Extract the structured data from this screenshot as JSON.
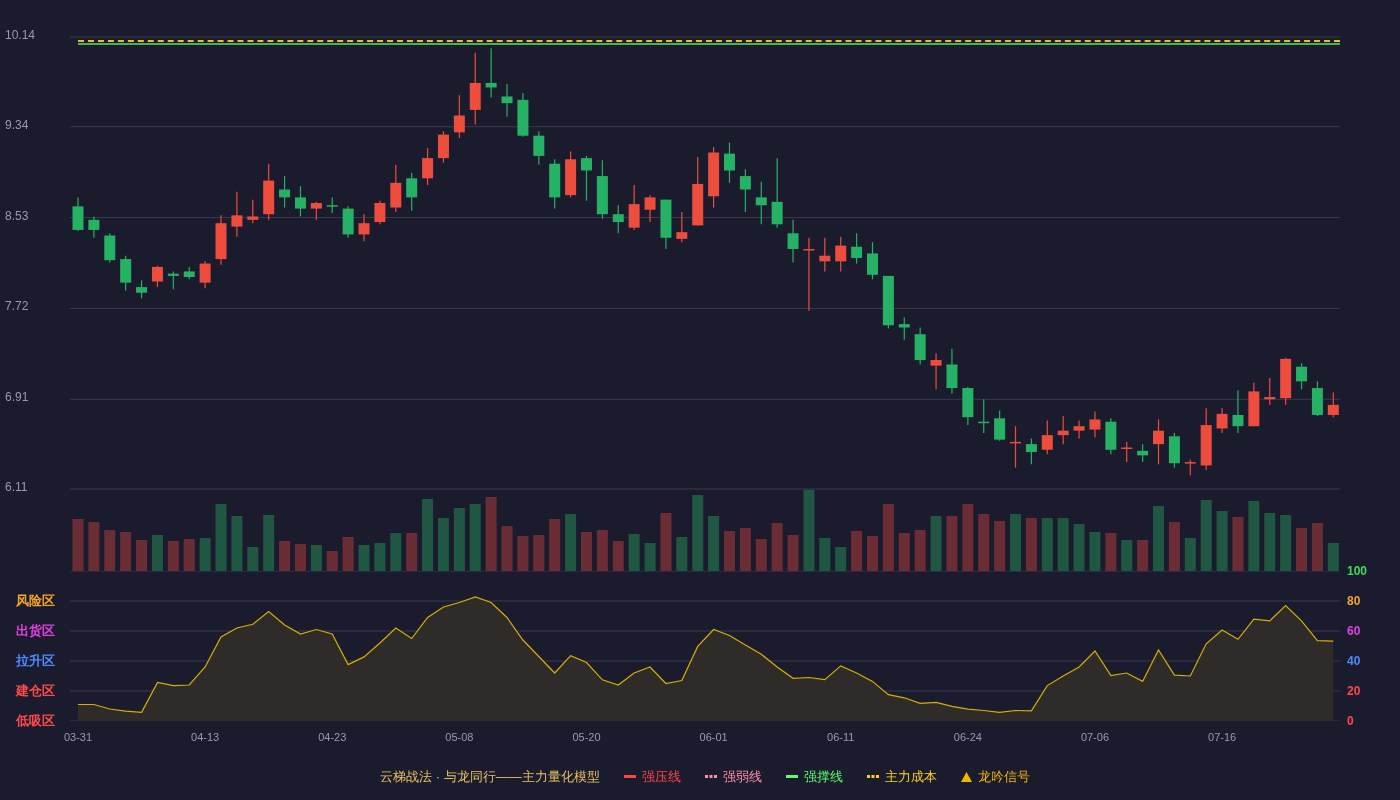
{
  "price_panel": {
    "guide_lines": [
      {
        "kind": "dashed",
        "color": "#e8c21a"
      },
      {
        "kind": "solid",
        "color": "#4caf50"
      }
    ],
    "chart_data": {
      "type": "candlestick",
      "ylim": [
        6.11,
        10.14
      ],
      "grid": true,
      "yticks": [
        {
          "value": 10.14,
          "label": "10.14"
        },
        {
          "value": 9.34,
          "label": "9.34"
        },
        {
          "value": 8.53,
          "label": "8.53"
        },
        {
          "value": 7.72,
          "label": "7.72"
        },
        {
          "value": 6.91,
          "label": "6.91"
        },
        {
          "value": 6.11,
          "label": "6.11"
        }
      ],
      "categories": [
        null,
        null,
        null,
        null,
        null,
        null,
        null,
        null,
        null,
        null,
        null,
        null,
        null,
        null,
        null,
        null,
        null,
        null,
        null,
        null,
        null,
        null,
        null,
        null,
        null,
        null,
        null,
        null,
        null,
        null,
        null,
        null,
        null,
        null,
        null,
        null,
        null,
        null,
        null,
        null,
        null,
        null,
        null,
        null,
        null,
        null,
        null,
        null,
        null,
        null,
        null,
        null,
        null,
        null,
        null,
        null,
        null,
        null,
        null,
        null,
        null,
        null,
        null,
        null,
        null,
        null,
        null,
        null,
        null,
        null,
        null,
        null,
        null,
        null,
        null,
        null,
        null,
        null,
        null,
        null
      ],
      "ohlc": [
        [
          8.63,
          8.71,
          8.41,
          8.42
        ],
        [
          8.51,
          8.54,
          8.35,
          8.42
        ],
        [
          8.37,
          8.39,
          8.13,
          8.15
        ],
        [
          8.16,
          8.19,
          7.88,
          7.95
        ],
        [
          7.91,
          7.97,
          7.81,
          7.86
        ],
        [
          7.96,
          8.1,
          7.91,
          8.09
        ],
        [
          8.03,
          8.05,
          7.89,
          8.01
        ],
        [
          8.05,
          8.09,
          7.98,
          8.0
        ],
        [
          7.95,
          8.14,
          7.9,
          8.12
        ],
        [
          8.16,
          8.55,
          8.11,
          8.48
        ],
        [
          8.45,
          8.76,
          8.36,
          8.55
        ],
        [
          8.51,
          8.69,
          8.48,
          8.54
        ],
        [
          8.56,
          9.01,
          8.51,
          8.86
        ],
        [
          8.78,
          8.9,
          8.62,
          8.71
        ],
        [
          8.71,
          8.81,
          8.54,
          8.61
        ],
        [
          8.61,
          8.67,
          8.51,
          8.66
        ],
        [
          8.64,
          8.71,
          8.57,
          8.63
        ],
        [
          8.61,
          8.63,
          8.35,
          8.38
        ],
        [
          8.38,
          8.56,
          8.32,
          8.48
        ],
        [
          8.49,
          8.68,
          8.47,
          8.66
        ],
        [
          8.62,
          9.0,
          8.58,
          8.84
        ],
        [
          8.88,
          8.93,
          8.59,
          8.71
        ],
        [
          8.88,
          9.15,
          8.82,
          9.06
        ],
        [
          9.06,
          9.3,
          9.02,
          9.27
        ],
        [
          9.29,
          9.62,
          9.24,
          9.44
        ],
        [
          9.49,
          10.0,
          9.36,
          9.73
        ],
        [
          9.73,
          10.04,
          9.6,
          9.69
        ],
        [
          9.61,
          9.72,
          9.43,
          9.55
        ],
        [
          9.58,
          9.64,
          9.25,
          9.26
        ],
        [
          9.26,
          9.3,
          9.0,
          9.08
        ],
        [
          9.01,
          9.05,
          8.61,
          8.71
        ],
        [
          8.73,
          9.12,
          8.71,
          9.05
        ],
        [
          9.06,
          9.08,
          8.68,
          8.95
        ],
        [
          8.9,
          9.04,
          8.52,
          8.56
        ],
        [
          8.56,
          8.64,
          8.39,
          8.49
        ],
        [
          8.44,
          8.82,
          8.42,
          8.65
        ],
        [
          8.6,
          8.73,
          8.49,
          8.71
        ],
        [
          8.69,
          8.69,
          8.25,
          8.35
        ],
        [
          8.34,
          8.58,
          8.31,
          8.4
        ],
        [
          8.46,
          9.07,
          8.46,
          8.83
        ],
        [
          8.72,
          9.16,
          8.62,
          9.11
        ],
        [
          9.1,
          9.2,
          8.84,
          8.95
        ],
        [
          8.9,
          8.96,
          8.58,
          8.78
        ],
        [
          8.71,
          8.85,
          8.47,
          8.64
        ],
        [
          8.67,
          9.06,
          8.44,
          8.47
        ],
        [
          8.39,
          8.51,
          8.13,
          8.25
        ],
        [
          8.24,
          8.35,
          7.7,
          8.25
        ],
        [
          8.14,
          8.35,
          8.05,
          8.19
        ],
        [
          8.14,
          8.36,
          8.05,
          8.28
        ],
        [
          8.27,
          8.39,
          8.12,
          8.17
        ],
        [
          8.21,
          8.31,
          7.98,
          8.02
        ],
        [
          8.01,
          8.01,
          7.54,
          7.57
        ],
        [
          7.58,
          7.64,
          7.44,
          7.55
        ],
        [
          7.49,
          7.55,
          7.22,
          7.26
        ],
        [
          7.21,
          7.32,
          7.0,
          7.26
        ],
        [
          7.22,
          7.36,
          6.96,
          7.01
        ],
        [
          7.01,
          7.02,
          6.68,
          6.75
        ],
        [
          6.71,
          6.91,
          6.61,
          6.7
        ],
        [
          6.74,
          6.81,
          6.54,
          6.55
        ],
        [
          6.52,
          6.67,
          6.3,
          6.53
        ],
        [
          6.51,
          6.56,
          6.33,
          6.44
        ],
        [
          6.46,
          6.72,
          6.42,
          6.59
        ],
        [
          6.59,
          6.76,
          6.51,
          6.63
        ],
        [
          6.63,
          6.72,
          6.56,
          6.67
        ],
        [
          6.64,
          6.8,
          6.57,
          6.73
        ],
        [
          6.71,
          6.74,
          6.42,
          6.46
        ],
        [
          6.47,
          6.53,
          6.35,
          6.48
        ],
        [
          6.45,
          6.51,
          6.35,
          6.41
        ],
        [
          6.51,
          6.73,
          6.33,
          6.63
        ],
        [
          6.58,
          6.61,
          6.3,
          6.34
        ],
        [
          6.34,
          6.37,
          6.23,
          6.35
        ],
        [
          6.32,
          6.83,
          6.28,
          6.68
        ],
        [
          6.65,
          6.83,
          6.61,
          6.78
        ],
        [
          6.77,
          6.99,
          6.61,
          6.67
        ],
        [
          6.67,
          7.06,
          6.67,
          6.98
        ],
        [
          6.91,
          7.1,
          6.86,
          6.93
        ],
        [
          6.92,
          7.28,
          6.86,
          7.27
        ],
        [
          7.2,
          7.23,
          7.0,
          7.07
        ],
        [
          7.01,
          7.07,
          6.76,
          6.77
        ],
        [
          6.77,
          6.97,
          6.75,
          6.86
        ]
      ]
    }
  },
  "indicator_panel": {
    "zones": [
      {
        "label": "风险区",
        "color": "#f5a623"
      },
      {
        "label": "出货区",
        "color": "#e040e0"
      },
      {
        "label": "拉升区",
        "color": "#4a8cff"
      },
      {
        "label": "建仓区",
        "color": "#ff4a4a"
      },
      {
        "label": "低吸区",
        "color": "#ff4a4a"
      }
    ],
    "tick_styles": [
      {
        "color": "#ff4a4a"
      },
      {
        "color": "#ff4a4a"
      },
      {
        "color": "#4a8cff"
      },
      {
        "color": "#e040e0"
      },
      {
        "color": "#f5a623"
      },
      {
        "color": "#3ddc5b"
      }
    ],
    "chart_data": {
      "type": "area",
      "ylim": [
        0,
        100
      ],
      "grid": true,
      "yticks": [
        {
          "value": 0,
          "label": "0"
        },
        {
          "value": 20,
          "label": "20"
        },
        {
          "value": 40,
          "label": "40"
        },
        {
          "value": 60,
          "label": "60"
        },
        {
          "value": 80,
          "label": "80"
        },
        {
          "value": 100,
          "label": "100"
        }
      ],
      "categories": [
        "03-31",
        null,
        null,
        null,
        null,
        null,
        null,
        null,
        "04-13",
        null,
        null,
        null,
        null,
        null,
        null,
        null,
        "04-23",
        null,
        null,
        null,
        null,
        null,
        null,
        null,
        "05-08",
        null,
        null,
        null,
        null,
        null,
        null,
        null,
        "05-20",
        null,
        null,
        null,
        null,
        null,
        null,
        null,
        "06-01",
        null,
        null,
        null,
        null,
        null,
        null,
        null,
        "06-11",
        null,
        null,
        null,
        null,
        null,
        null,
        null,
        "06-24",
        null,
        null,
        null,
        null,
        null,
        null,
        null,
        "07-06",
        null,
        null,
        null,
        null,
        null,
        null,
        null,
        "07-16",
        null,
        null,
        null,
        null,
        null,
        null,
        null
      ],
      "series": [
        {
          "color": "#d4b000",
          "values": [
            11,
            11,
            8,
            6.6,
            5.7,
            25.7,
            23.6,
            24,
            36,
            56,
            62,
            64.5,
            73,
            64,
            58,
            61,
            58,
            37.6,
            42.7,
            52,
            62,
            55,
            69,
            76,
            79,
            82.7,
            79,
            69,
            54,
            43,
            32,
            43.6,
            39,
            27.5,
            24,
            32,
            36,
            25,
            27,
            49.7,
            61,
            57,
            50.6,
            44.5,
            36,
            28.5,
            29,
            27.6,
            36.7,
            32,
            26.4,
            17.6,
            15.5,
            11.8,
            12.4,
            9.7,
            7.9,
            7,
            5.8,
            7,
            6.7,
            23.6,
            30,
            36,
            46.7,
            30.3,
            32,
            26.4,
            47.3,
            30.6,
            30,
            51.5,
            60.6,
            54.5,
            67.9,
            66.7,
            77,
            66.7,
            53.6,
            53.3
          ]
        }
      ]
    }
  },
  "legend": {
    "title": "云梯战法 · 与龙同行——主力量化模型",
    "items": [
      {
        "label": "强压线",
        "color": "#ff4444",
        "kind": "solid"
      },
      {
        "label": "强弱线",
        "color": "#ff8fa8",
        "kind": "dashed"
      },
      {
        "label": "强撑线",
        "color": "#5cff6a",
        "kind": "solid"
      },
      {
        "label": "主力成本",
        "color": "#ffd21a",
        "kind": "dashed"
      },
      {
        "label": "龙吟信号",
        "color": "#f5b400",
        "kind": "triangle"
      }
    ]
  }
}
